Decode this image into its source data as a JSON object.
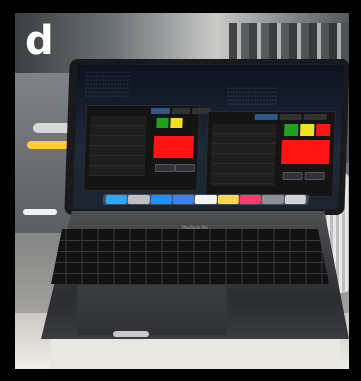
{
  "panel_label": "d",
  "laptop": {
    "model": "MacBook Pro"
  },
  "colors": {
    "background": "#000000",
    "status_green": "#22a11a",
    "status_yellow": "#f1e21a",
    "status_red": "#ff1313",
    "dock": "#b4bec8"
  },
  "icons": [
    "finder-icon",
    "launchpad-icon",
    "safari-icon",
    "mail-icon",
    "calendar-icon",
    "notes-icon",
    "music-icon",
    "settings-icon",
    "trash-icon"
  ]
}
